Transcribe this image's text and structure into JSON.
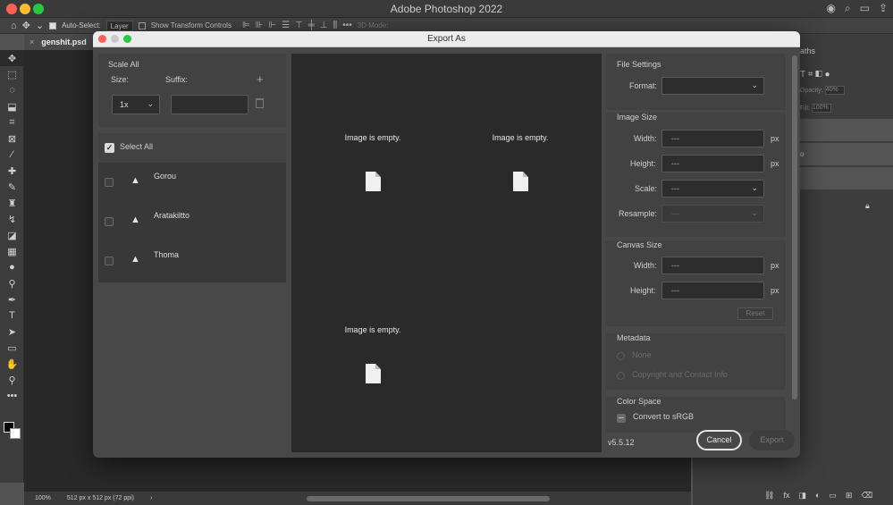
{
  "app": {
    "title": "Adobe Photoshop 2022",
    "document_tab": "genshit.psd",
    "zoom": "100%",
    "doc_info": "512 px x 512 px (72 ppi)"
  },
  "options_bar": {
    "auto_select_label": "Auto-Select:",
    "auto_select_value": "Layer",
    "transform_label": "Show Transform Controls",
    "mode_3d_label": "3D Mode:"
  },
  "right_panel": {
    "tabs_text": "aths",
    "opacity_label": "Opacity:",
    "opacity_value": "40%",
    "fill_label": "Fill:",
    "fill_value": "100%",
    "layer_partial": "o"
  },
  "dialog": {
    "title": "Export As",
    "scale_all": {
      "header": "Scale All",
      "size_label": "Size:",
      "suffix_label": "Suffix:",
      "size_value": "1x",
      "suffix_value": ""
    },
    "select_all_label": "Select All",
    "layers": [
      {
        "name": "Gorou"
      },
      {
        "name": "Aratakiltto"
      },
      {
        "name": "Thoma"
      }
    ],
    "preview_message": "Image is empty.",
    "file_settings": {
      "header": "File Settings",
      "format_label": "Format:",
      "format_value": ""
    },
    "image_size": {
      "header": "Image Size",
      "width_label": "Width:",
      "width_value": "---",
      "height_label": "Height:",
      "height_value": "---",
      "scale_label": "Scale:",
      "scale_value": "---",
      "resample_label": "Resample:",
      "resample_value": "---",
      "unit": "px"
    },
    "canvas_size": {
      "header": "Canvas Size",
      "width_label": "Width:",
      "width_value": "---",
      "height_label": "Height:",
      "height_value": "---",
      "unit": "px",
      "reset_label": "Reset"
    },
    "metadata": {
      "header": "Metadata",
      "option_none": "None",
      "option_copyright": "Copyright and Contact Info"
    },
    "color_space": {
      "header": "Color Space",
      "convert_label": "Convert to sRGB"
    },
    "version": "v5.5.12",
    "cancel_label": "Cancel",
    "export_label": "Export"
  }
}
